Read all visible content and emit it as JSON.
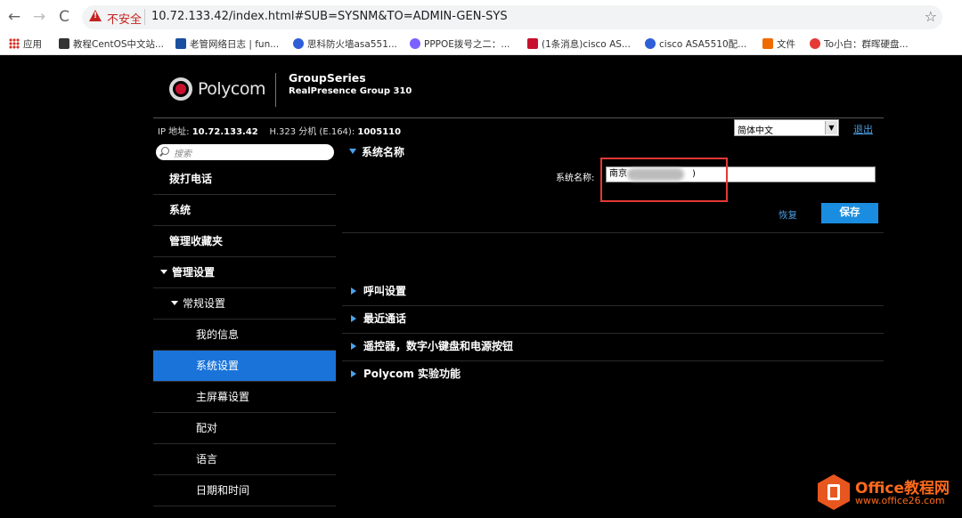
{
  "browser": {
    "insecure_label": "不安全",
    "url": "10.72.133.42/index.html#SUB=SYSNM&TO=ADMIN-GEN-SYS",
    "bookmarks": [
      {
        "label": "应用",
        "color": "#d93025"
      },
      {
        "label": "教程CentOS中文站...",
        "color": "#333333"
      },
      {
        "label": "老管网络日志 | fun...",
        "color": "#1a4fa0"
      },
      {
        "label": "思科防火墙asa551...",
        "color": "#2f5fd6"
      },
      {
        "label": "PPPOE拨号之二：...",
        "color": "#7b61ff"
      },
      {
        "label": "(1条消息)cisco AS...",
        "color": "#c8102e"
      },
      {
        "label": "cisco ASA5510配...",
        "color": "#2f5fd6"
      },
      {
        "label": "文件",
        "color": "#ef6c00"
      },
      {
        "label": "To小白：群晖硬盘...",
        "color": "#e53935"
      }
    ]
  },
  "header": {
    "logo_text": "Polycom",
    "product_line1": "GroupSeries",
    "product_line2": "RealPresence Group 310"
  },
  "info_bar": {
    "ip_label": "IP 地址:",
    "ip_value": "10.72.133.42",
    "h323_label": "H.323 分机 (E.164):",
    "h323_value": "1005110",
    "language": "简体中文",
    "logout": "退出"
  },
  "sidebar": {
    "search_placeholder": "搜索",
    "items": [
      {
        "label": "拨打电话"
      },
      {
        "label": "系统"
      },
      {
        "label": "管理收藏夹"
      },
      {
        "label": "管理设置"
      },
      {
        "label": "常规设置"
      },
      {
        "label": "我的信息"
      },
      {
        "label": "系统设置"
      },
      {
        "label": "主屏幕设置"
      },
      {
        "label": "配对"
      },
      {
        "label": "语言"
      },
      {
        "label": "日期和时间"
      }
    ]
  },
  "main": {
    "system_name_section": "系统名称",
    "system_name_label": "系统名称:",
    "system_name_value": "南京",
    "system_name_tail": ")",
    "revert": "恢复",
    "save": "保存",
    "sections": [
      {
        "label": "呼叫设置"
      },
      {
        "label": "最近通话"
      },
      {
        "label": "遥控器，数字小键盘和电源按钮"
      },
      {
        "label": "Polycom 实验功能"
      }
    ]
  },
  "watermark": {
    "title": "Office教程网",
    "url": "www.office26.com"
  }
}
